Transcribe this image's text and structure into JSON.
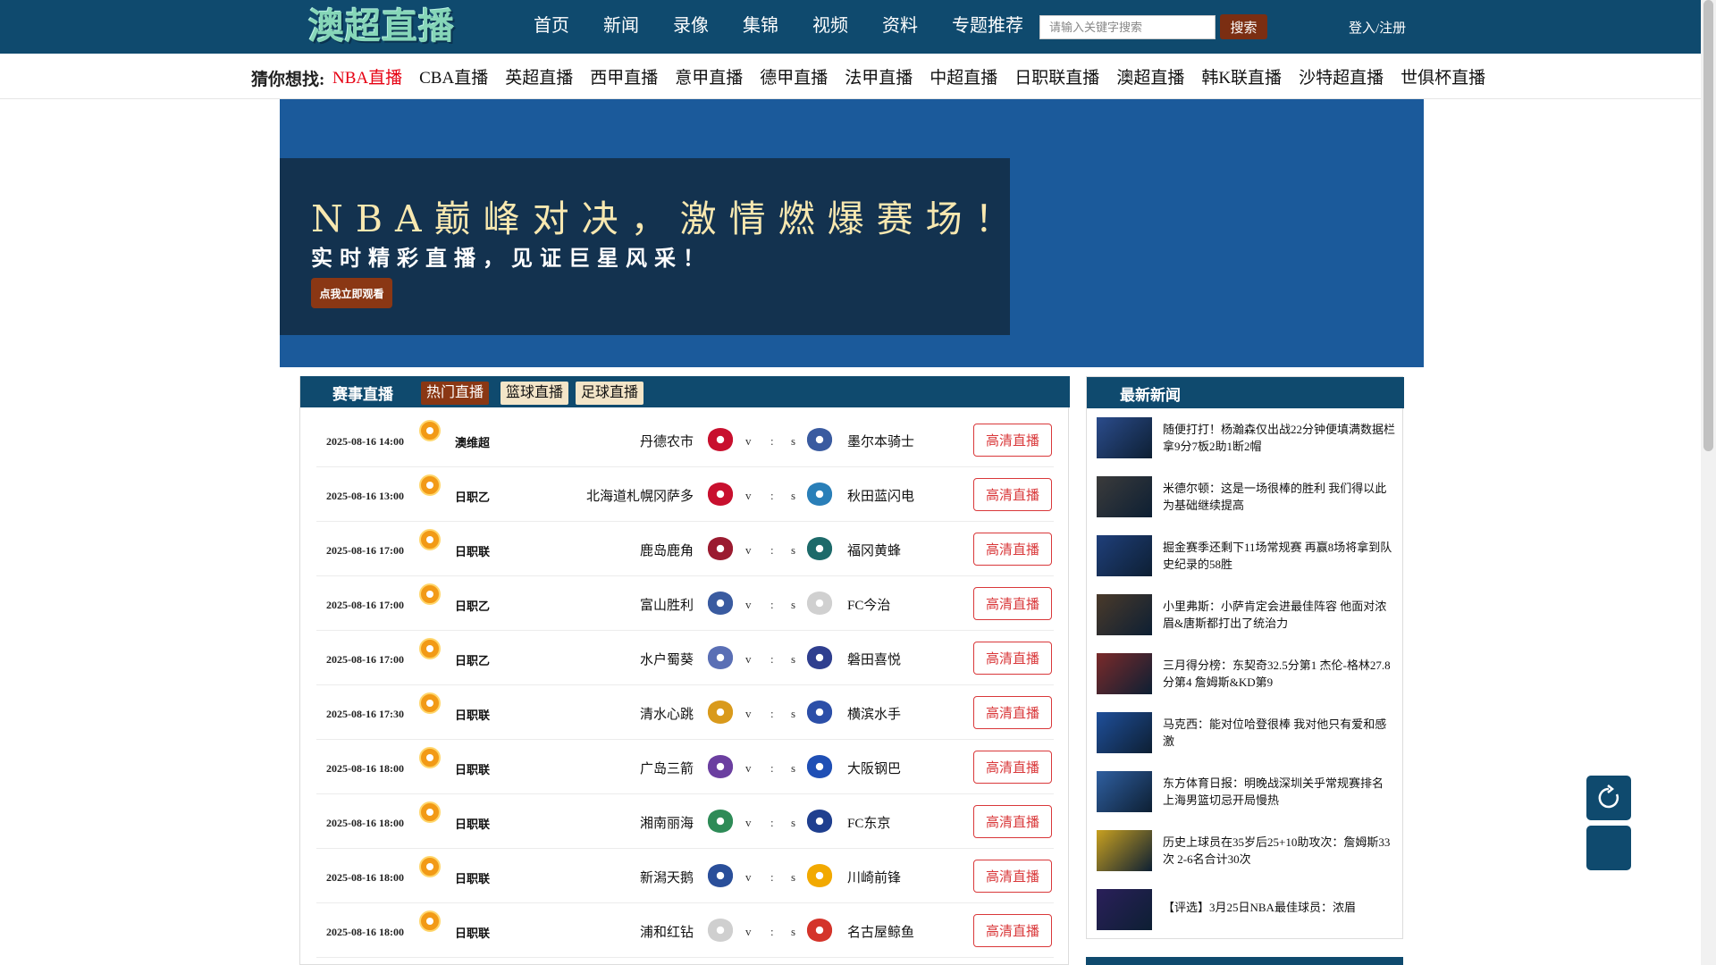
{
  "header": {
    "logo_text": "澳超直播",
    "nav": [
      "首页",
      "新闻",
      "录像",
      "集锦",
      "视频",
      "资料",
      "专题推荐"
    ],
    "search_placeholder": "请输入关键字搜索",
    "search_button": "搜索",
    "login": "登入/注册"
  },
  "guess": {
    "title": "猜你想找:",
    "links": [
      "NBA直播",
      "CBA直播",
      "英超直播",
      "西甲直播",
      "意甲直播",
      "德甲直播",
      "法甲直播",
      "中超直播",
      "日职联直播",
      "澳超直播",
      "韩K联直播",
      "沙特超直播",
      "世俱杯直播"
    ]
  },
  "banner": {
    "headline": "NBA巅峰对决，激情燃爆赛场！",
    "subline": "实时精彩直播，见证巨星风采！",
    "button": "点我立即观看"
  },
  "matches": {
    "title": "赛事直播",
    "tabs": [
      "热门直播",
      "篮球直播",
      "足球直播"
    ],
    "rows": [
      {
        "time": "2025-08-16 14:00",
        "league": "澳维超",
        "home": "丹德农市",
        "away": "墨尔本骑士",
        "v": "v",
        "colon": ":",
        "s": "s",
        "button": "高清直播"
      },
      {
        "time": "2025-08-16 13:00",
        "league": "日职乙",
        "home": "北海道札幌冈萨多",
        "away": "秋田蓝闪电",
        "v": "v",
        "colon": ":",
        "s": "s",
        "button": "高清直播"
      },
      {
        "time": "2025-08-16 17:00",
        "league": "日职联",
        "home": "鹿岛鹿角",
        "away": "福冈黄蜂",
        "v": "v",
        "colon": ":",
        "s": "s",
        "button": "高清直播"
      },
      {
        "time": "2025-08-16 17:00",
        "league": "日职乙",
        "home": "富山胜利",
        "away": "FC今治",
        "v": "v",
        "colon": ":",
        "s": "s",
        "button": "高清直播"
      },
      {
        "time": "2025-08-16 17:00",
        "league": "日职乙",
        "home": "水户蜀葵",
        "away": "磐田喜悦",
        "v": "v",
        "colon": ":",
        "s": "s",
        "button": "高清直播"
      },
      {
        "time": "2025-08-16 17:30",
        "league": "日职联",
        "home": "清水心跳",
        "away": "横滨水手",
        "v": "v",
        "colon": ":",
        "s": "s",
        "button": "高清直播"
      },
      {
        "time": "2025-08-16 18:00",
        "league": "日职联",
        "home": "广岛三箭",
        "away": "大阪钢巴",
        "v": "v",
        "colon": ":",
        "s": "s",
        "button": "高清直播"
      },
      {
        "time": "2025-08-16 18:00",
        "league": "日职联",
        "home": "湘南丽海",
        "away": "FC东京",
        "v": "v",
        "colon": ":",
        "s": "s",
        "button": "高清直播"
      },
      {
        "time": "2025-08-16 18:00",
        "league": "日职联",
        "home": "新潟天鹅",
        "away": "川崎前锋",
        "v": "v",
        "colon": ":",
        "s": "s",
        "button": "高清直播"
      },
      {
        "time": "2025-08-16 18:00",
        "league": "日职联",
        "home": "浦和红钻",
        "away": "名古屋鲸鱼",
        "v": "v",
        "colon": ":",
        "s": "s",
        "button": "高清直播"
      }
    ]
  },
  "news": {
    "title": "最新新闻",
    "items": [
      {
        "text": "随便打打！杨瀚森仅出战22分钟便填满数据栏 拿9分7板2助1断2帽"
      },
      {
        "text": "米德尔顿：这是一场很棒的胜利 我们得以此为基础继续提高"
      },
      {
        "text": "掘金赛季还剩下11场常规赛 再赢8场将拿到队史纪录的58胜"
      },
      {
        "text": "小里弗斯：小萨肯定会进最佳阵容 他面对浓眉&唐斯都打出了统治力"
      },
      {
        "text": "三月得分榜：东契奇32.5分第1 杰伦-格林27.8分第4 詹姆斯&KD第9"
      },
      {
        "text": "马克西：能对位哈登很棒 我对他只有爱和感激"
      },
      {
        "text": "东方体育日报：明晚战深圳关乎常规赛排名 上海男篮切忌开局慢热"
      },
      {
        "text": "历史上球员在35岁后25+10助攻次：詹姆斯33次 2-6名合计30次"
      },
      {
        "text": "【评选】3月25日NBA最佳球员：浓眉"
      }
    ]
  },
  "colors": {
    "header_bg": "#0f4a6e",
    "banner_bg": "#1b5a9b",
    "accent_brown": "#8a3714",
    "live_button": "#d9383a",
    "active_link": "#e60012"
  }
}
